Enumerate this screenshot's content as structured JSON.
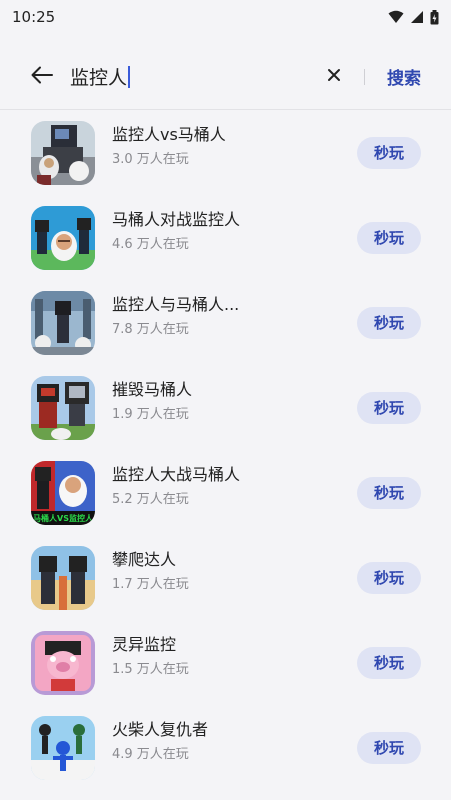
{
  "status": {
    "time": "10:25"
  },
  "search": {
    "query": "监控人",
    "action_label": "搜索"
  },
  "apps": [
    {
      "name": "监控人vs马桶人",
      "players": "3.0 万人在玩",
      "play_label": "秒玩"
    },
    {
      "name": "马桶人对战监控人",
      "players": "4.6 万人在玩",
      "play_label": "秒玩"
    },
    {
      "name": "监控人与马桶人...",
      "players": "7.8 万人在玩",
      "play_label": "秒玩"
    },
    {
      "name": "摧毁马桶人",
      "players": "1.9 万人在玩",
      "play_label": "秒玩"
    },
    {
      "name": "监控人大战马桶人",
      "players": "5.2 万人在玩",
      "play_label": "秒玩",
      "icon_banner": "马桶人VS监控人"
    },
    {
      "name": "攀爬达人",
      "players": "1.7 万人在玩",
      "play_label": "秒玩"
    },
    {
      "name": "灵异监控",
      "players": "1.5 万人在玩",
      "play_label": "秒玩"
    },
    {
      "name": "火柴人复仇者",
      "players": "4.9 万人在玩",
      "play_label": "秒玩"
    }
  ],
  "colors": {
    "accent": "#3048b0",
    "button_bg": "#dfe3f4",
    "background": "#f4f4f7"
  }
}
